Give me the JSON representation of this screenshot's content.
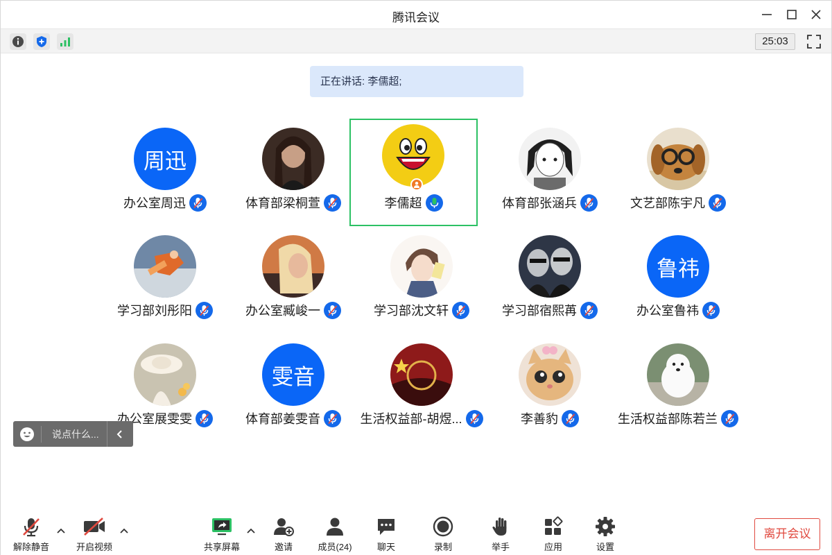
{
  "window": {
    "title": "腾讯会议",
    "timer": "25:03"
  },
  "speaking": {
    "text": "正在讲话: 李儒超;"
  },
  "participants": [
    {
      "name": "办公室周迅",
      "avatar_text": "周迅"
    },
    {
      "name": "体育部梁桐萱"
    },
    {
      "name": "李儒超",
      "active": true,
      "host": true
    },
    {
      "name": "体育部张涵兵"
    },
    {
      "name": "文艺部陈宇凡"
    },
    {
      "name": "学习部刘彤阳"
    },
    {
      "name": "办公室臧峻一"
    },
    {
      "name": "学习部沈文轩"
    },
    {
      "name": "学习部宿熙苒"
    },
    {
      "name": "办公室鲁祎",
      "avatar_text": "鲁祎"
    },
    {
      "name": "办公室展雯雯"
    },
    {
      "name": "体育部姜雯音",
      "avatar_text": "雯音"
    },
    {
      "name": "生活权益部-胡煜..."
    },
    {
      "name": "李善豹"
    },
    {
      "name": "生活权益部陈若兰"
    }
  ],
  "chat": {
    "placeholder": "说点什么..."
  },
  "bottombar": {
    "unmute": "解除静音",
    "start_video": "开启视频",
    "share_screen": "共享屏幕",
    "invite": "邀请",
    "members": "成员(24)",
    "chat": "聊天",
    "record": "录制",
    "raise_hand": "举手",
    "apps": "应用",
    "settings": "设置",
    "leave": "离开会议"
  },
  "colors": {
    "accent": "#0a66f7",
    "active_border": "#2cc164",
    "leave": "#e0493f",
    "speaking_bg": "#dbe8fb"
  }
}
